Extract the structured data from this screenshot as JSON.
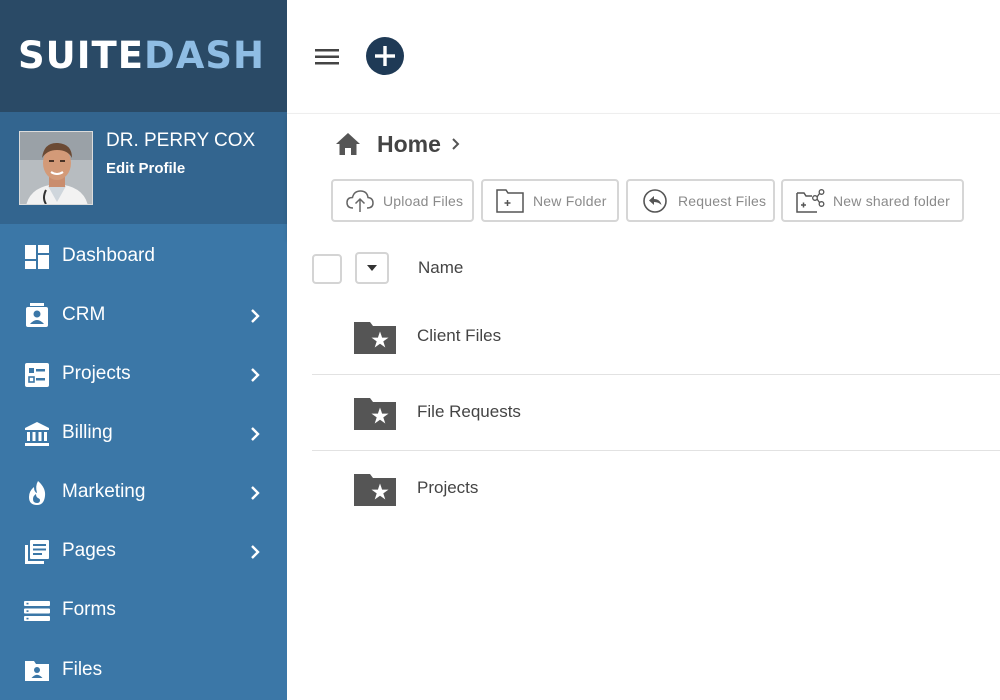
{
  "brand": {
    "logo_part1": "SUITE",
    "logo_part2": "DASH",
    "sidebar_color": "#3b77a7",
    "header_color": "#2a4a66",
    "accent": "#1f3a56"
  },
  "profile": {
    "name": "DR. PERRY COX",
    "edit_label": "Edit Profile"
  },
  "sidebar": {
    "items": [
      {
        "label": "Dashboard",
        "icon": "dashboard-icon",
        "has_submenu": false
      },
      {
        "label": "CRM",
        "icon": "contact-card-icon",
        "has_submenu": true
      },
      {
        "label": "Projects",
        "icon": "checklist-icon",
        "has_submenu": true
      },
      {
        "label": "Billing",
        "icon": "bank-icon",
        "has_submenu": true
      },
      {
        "label": "Marketing",
        "icon": "flame-icon",
        "has_submenu": true
      },
      {
        "label": "Pages",
        "icon": "pages-icon",
        "has_submenu": true
      },
      {
        "label": "Forms",
        "icon": "forms-icon",
        "has_submenu": false
      },
      {
        "label": "Files",
        "icon": "folder-user-icon",
        "has_submenu": false
      }
    ]
  },
  "breadcrumb": {
    "home_label": "Home"
  },
  "toolbar": {
    "upload_label": "Upload Files",
    "new_folder_label": "New Folder",
    "request_label": "Request Files",
    "shared_label": "New shared folder"
  },
  "list": {
    "column_name": "Name",
    "rows": [
      {
        "name": "Client Files",
        "icon": "starred-folder-icon"
      },
      {
        "name": "File Requests",
        "icon": "starred-folder-icon"
      },
      {
        "name": "Projects",
        "icon": "starred-folder-icon"
      }
    ]
  }
}
